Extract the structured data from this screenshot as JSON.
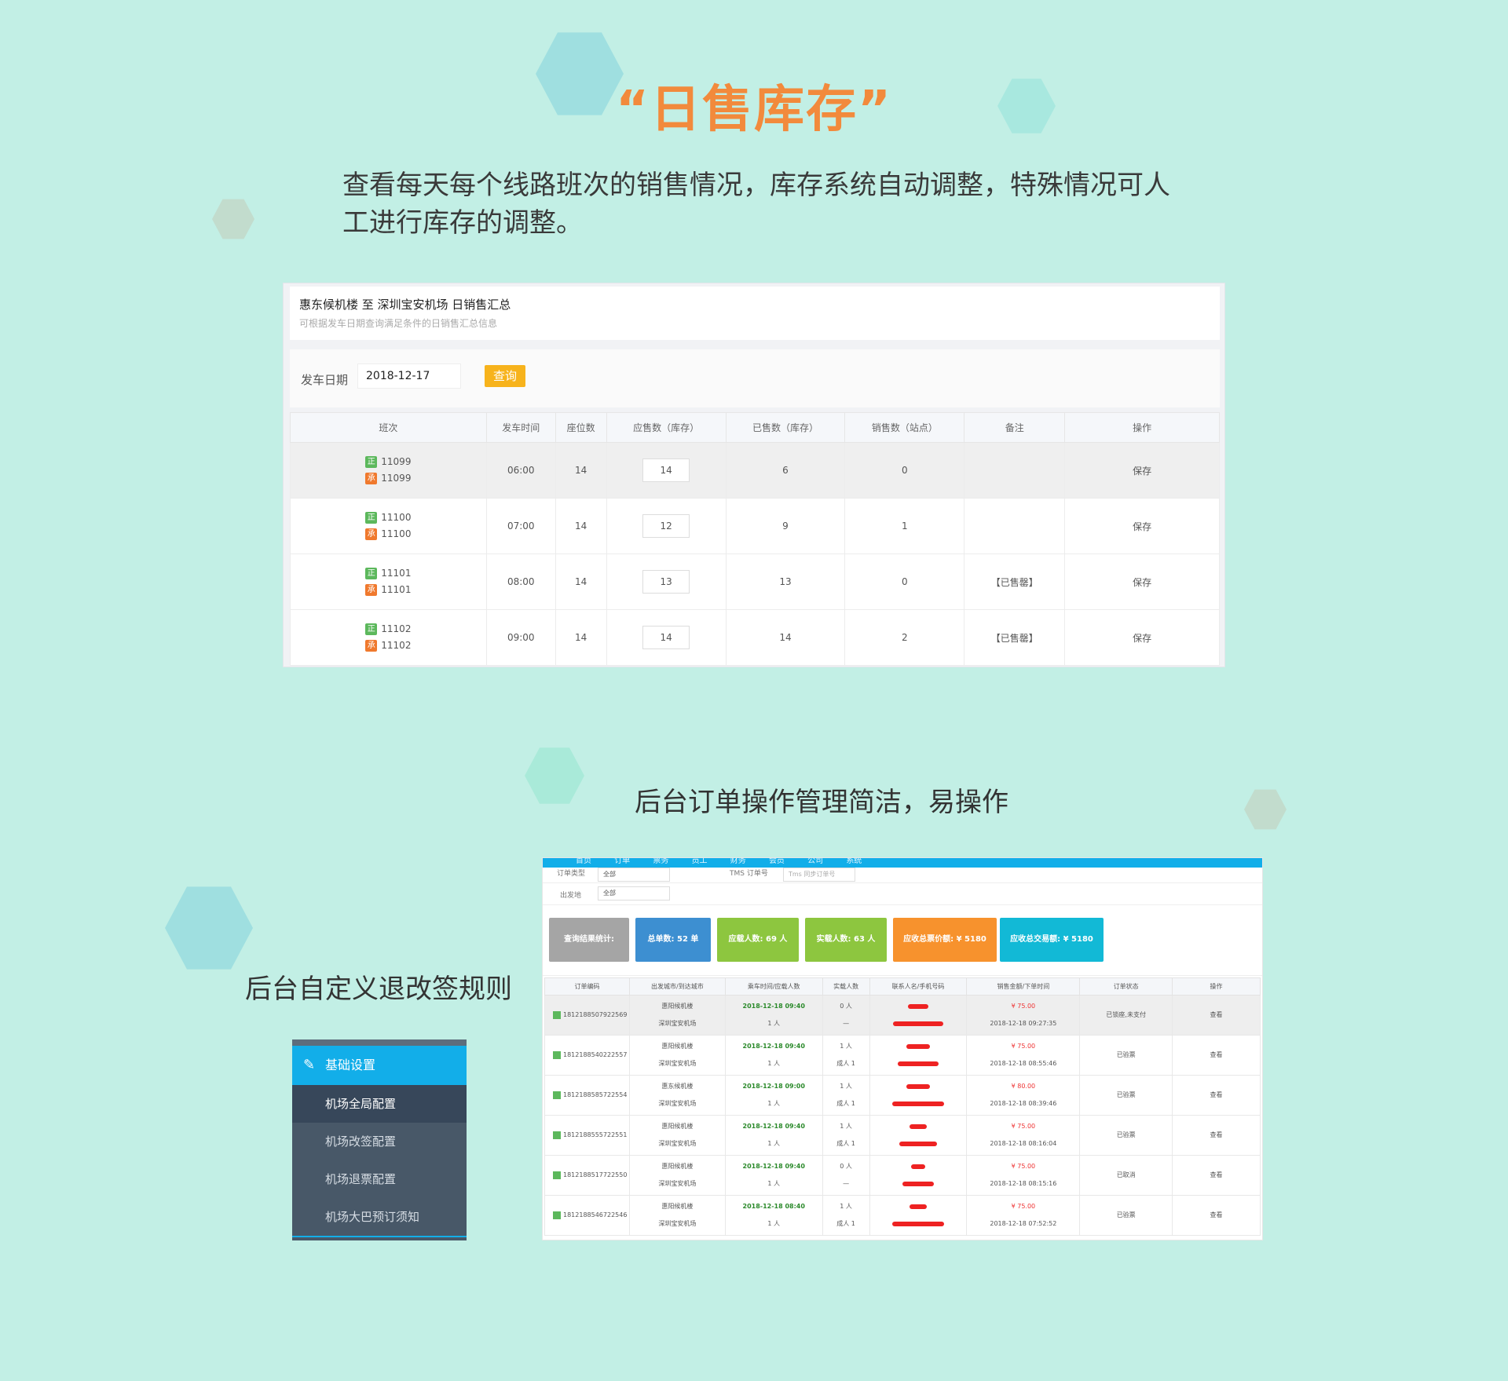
{
  "title": "“日售库存”",
  "description": "查看每天每个线路班次的销售情况，库存系统自动调整，特殊情况可人工进行库存的调整。",
  "subtitle_orders": "后台订单操作管理简洁，易操作",
  "subtitle_rules": "后台自定义退改签规则",
  "sales_panel": {
    "title": "惠东候机楼 至 深圳宝安机场 日销售汇总",
    "subtitle": "可根据发车日期查询满足条件的日销售汇总信息",
    "date_label": "发车日期",
    "date_value": "2018-12-17",
    "query_button": "查询",
    "headers": [
      "班次",
      "发车时间",
      "座位数",
      "应售数（库存）",
      "已售数（库存）",
      "销售数（站点）",
      "备注",
      "操作"
    ],
    "tag_main": "正",
    "tag_sub": "承",
    "rows": [
      {
        "code": "11099",
        "time": "06:00",
        "seats": "14",
        "stock": "14",
        "sold": "6",
        "station": "0",
        "note": "",
        "action": "保存"
      },
      {
        "code": "11100",
        "time": "07:00",
        "seats": "14",
        "stock": "12",
        "sold": "9",
        "station": "1",
        "note": "",
        "action": "保存"
      },
      {
        "code": "11101",
        "time": "08:00",
        "seats": "14",
        "stock": "13",
        "sold": "13",
        "station": "0",
        "note": "【已售罄】",
        "action": "保存"
      },
      {
        "code": "11102",
        "time": "09:00",
        "seats": "14",
        "stock": "14",
        "sold": "14",
        "station": "2",
        "note": "【已售罄】",
        "action": "保存"
      }
    ]
  },
  "sidebar": {
    "section": "基础设置",
    "items": [
      "机场全局配置",
      "机场改签配置",
      "机场退票配置",
      "机场大巴预订须知"
    ]
  },
  "orders_panel": {
    "nav": [
      "首页",
      "订单",
      "票务",
      "员工",
      "财务",
      "会员",
      "公司",
      "系统"
    ],
    "filter_order_type_label": "订单类型",
    "filter_order_type_value": "全部",
    "filter_tms_label": "TMS 订单号",
    "filter_tms_placeholder": "Tms 同步订单号",
    "filter_origin_label": "出发地",
    "filter_origin_value": "全部",
    "stats": [
      {
        "label": "查询结果统计:",
        "color": "#a5a5a5"
      },
      {
        "label": "总单数:  52 单",
        "color": "#3d8fd1"
      },
      {
        "label": "应载人数:  69 人",
        "color": "#8dc63f"
      },
      {
        "label": "实载人数:  63 人",
        "color": "#8dc63f"
      },
      {
        "label": "应收总票价额:  ¥ 5180",
        "color": "#f7922d"
      },
      {
        "label": "应收总交易额:  ¥ 5180",
        "color": "#12b9d6"
      }
    ],
    "headers": [
      "订单编码",
      "出发城市/到达城市",
      "乘车时间/应载人数",
      "实载人数",
      "联系人名/手机号码",
      "销售金额/下单时间",
      "订单状态",
      "操作"
    ],
    "rows": [
      {
        "id": "1812188507922569",
        "from": "惠阳候机楼",
        "to": "深圳宝安机场",
        "datetime": "2018-12-18 09:40",
        "count": "1 人",
        "actual": "0 人",
        "actual2": "—",
        "amount": "¥ 75.00",
        "ordered": "2018-12-18 09:27:35",
        "status": "已锁座,未支付",
        "action": "查看"
      },
      {
        "id": "1812188540222557",
        "from": "惠阳候机楼",
        "to": "深圳宝安机场",
        "datetime": "2018-12-18 09:40",
        "count": "1 人",
        "actual": "1 人",
        "actual2": "成人 1",
        "amount": "¥ 75.00",
        "ordered": "2018-12-18 08:55:46",
        "status": "已验票",
        "action": "查看"
      },
      {
        "id": "1812188585722554",
        "from": "惠东候机楼",
        "to": "深圳宝安机场",
        "datetime": "2018-12-18 09:00",
        "count": "1 人",
        "actual": "1 人",
        "actual2": "成人 1",
        "amount": "¥ 80.00",
        "ordered": "2018-12-18 08:39:46",
        "status": "已验票",
        "action": "查看"
      },
      {
        "id": "1812188555722551",
        "from": "惠阳候机楼",
        "to": "深圳宝安机场",
        "datetime": "2018-12-18 09:40",
        "count": "1 人",
        "actual": "1 人",
        "actual2": "成人 1",
        "amount": "¥ 75.00",
        "ordered": "2018-12-18 08:16:04",
        "status": "已验票",
        "action": "查看"
      },
      {
        "id": "1812188517722550",
        "from": "惠阳候机楼",
        "to": "深圳宝安机场",
        "datetime": "2018-12-18 09:40",
        "count": "1 人",
        "actual": "0 人",
        "actual2": "—",
        "amount": "¥ 75.00",
        "ordered": "2018-12-18 08:15:16",
        "status": "已取消",
        "action": "查看"
      },
      {
        "id": "1812188546722546",
        "from": "惠阳候机楼",
        "to": "深圳宝安机场",
        "datetime": "2018-12-18 08:40",
        "count": "1 人",
        "actual": "1 人",
        "actual2": "成人 1",
        "amount": "¥ 75.00",
        "ordered": "2018-12-18 07:52:52",
        "status": "已验票",
        "action": "查看"
      }
    ]
  }
}
